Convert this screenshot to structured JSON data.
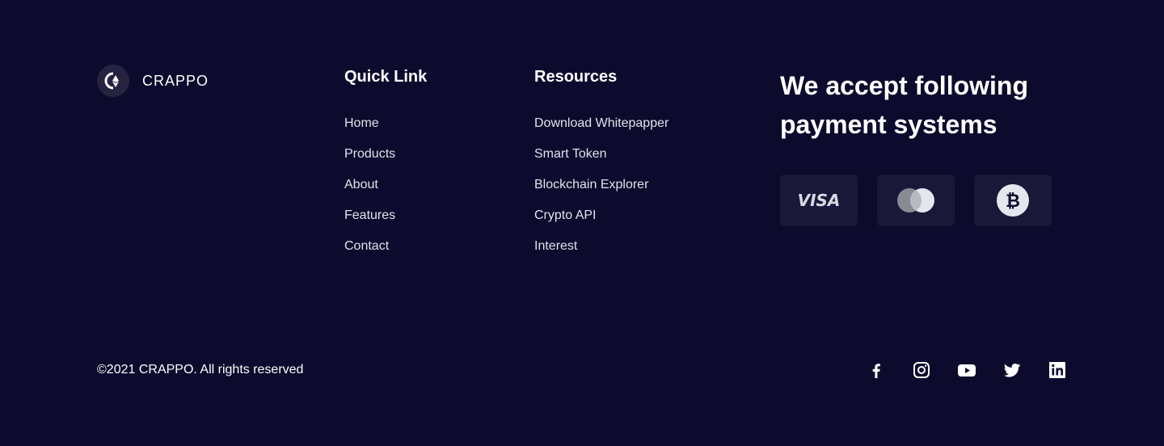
{
  "brand": {
    "name": "CRAPPO",
    "logo_icon": "crappo-logo-icon"
  },
  "quick_links": {
    "title": "Quick Link",
    "items": [
      "Home",
      "Products",
      "About",
      "Features",
      "Contact"
    ]
  },
  "resources": {
    "title": "Resources",
    "items": [
      "Download Whitepapper",
      "Smart Token",
      "Blockchain Explorer",
      "Crypto API",
      "Interest"
    ]
  },
  "payment": {
    "title": "We accept following payment systems",
    "methods": [
      {
        "name": "VISA",
        "icon": "visa-icon"
      },
      {
        "icon": "mastercard-icon"
      },
      {
        "icon": "bitcoin-icon"
      }
    ]
  },
  "footer": {
    "copyright": "©2021 CRAPPO. All rights reserved"
  },
  "social": [
    "facebook-icon",
    "instagram-icon",
    "youtube-icon",
    "twitter-icon",
    "linkedin-icon"
  ],
  "colors": {
    "background": "#0d0b2d",
    "card": "#1a1838",
    "text": "#ffffff"
  }
}
